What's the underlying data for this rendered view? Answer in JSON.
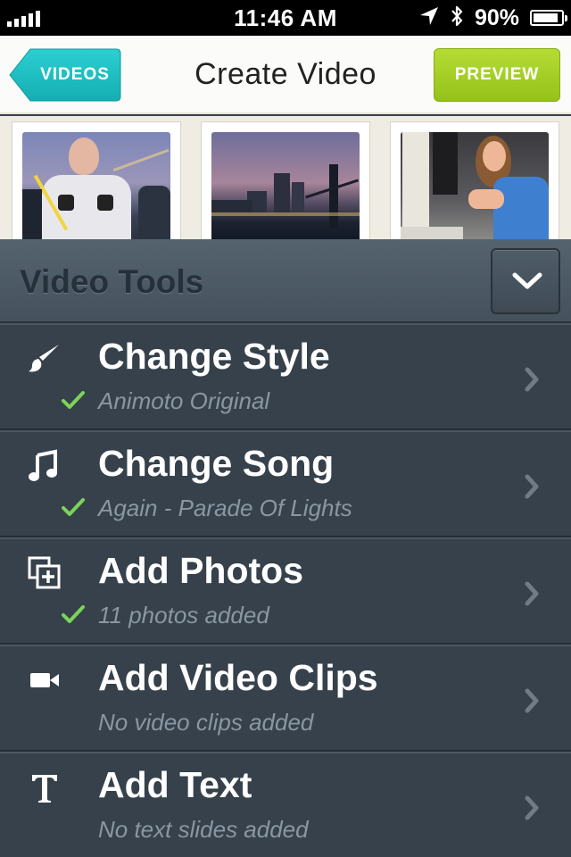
{
  "status_bar": {
    "time": "11:46 AM",
    "battery": "90%",
    "battery_level": 0.9,
    "icons": [
      "signal-icon",
      "location-arrow-icon",
      "bluetooth-icon",
      "battery-icon"
    ]
  },
  "nav": {
    "back_label": "VIDEOS",
    "title": "Create Video",
    "preview_label": "PREVIEW"
  },
  "thumbnails": [
    {
      "name": "photo-man-bridge"
    },
    {
      "name": "photo-city-skyline"
    },
    {
      "name": "photo-woman-party"
    }
  ],
  "tools": {
    "title": "Video Tools",
    "collapse_icon": "chevron-down-icon",
    "items": [
      {
        "icon": "paintbrush-icon",
        "title": "Change Style",
        "subtitle": "Animoto Original",
        "checked": true
      },
      {
        "icon": "music-note-icon",
        "title": "Change Song",
        "subtitle": "Again - Parade Of Lights",
        "checked": true
      },
      {
        "icon": "add-photos-icon",
        "title": "Add Photos",
        "subtitle": "11 photos added",
        "checked": true
      },
      {
        "icon": "video-camera-icon",
        "title": "Add Video Clips",
        "subtitle": "No video clips added",
        "checked": false
      },
      {
        "icon": "text-icon",
        "title": "Add Text",
        "subtitle": "No text slides added",
        "checked": false
      }
    ]
  },
  "colors": {
    "back_button": "#1fc0c3",
    "preview_button": "#a6cf2a",
    "check": "#7dd35a",
    "panel": "#36414b",
    "subtitle": "#8a97a3"
  }
}
